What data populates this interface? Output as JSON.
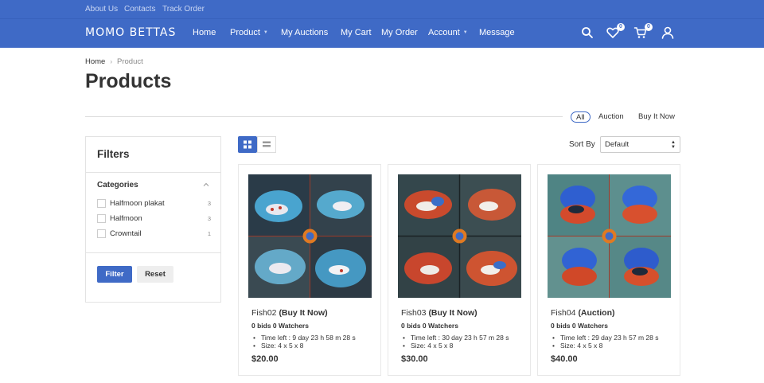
{
  "topbar": {
    "links": [
      "About Us",
      "Contacts",
      "Track Order"
    ]
  },
  "navbar": {
    "logo": "MOMO BETTAS",
    "items": [
      {
        "label": "Home",
        "dropdown": false
      },
      {
        "label": "Product",
        "dropdown": true
      },
      {
        "label": "My Auctions",
        "dropdown": false
      },
      {
        "label": "My Cart",
        "dropdown": false
      },
      {
        "label": "My Order",
        "dropdown": false
      },
      {
        "label": "Account",
        "dropdown": true
      },
      {
        "label": "Message",
        "dropdown": false
      }
    ],
    "icons": {
      "search": "search-icon",
      "wishlist": "heart-icon",
      "wishlist_count": "0",
      "cart": "cart-icon",
      "cart_count": "0",
      "account": "user-icon"
    }
  },
  "breadcrumb": {
    "home": "Home",
    "current": "Product"
  },
  "page_title": "Products",
  "type_tabs": [
    {
      "label": "All",
      "active": true
    },
    {
      "label": "Auction",
      "active": false
    },
    {
      "label": "Buy It Now",
      "active": false
    }
  ],
  "filters": {
    "title": "Filters",
    "categories_title": "Categories",
    "categories": [
      {
        "label": "Halfmoon plakat",
        "count": "3"
      },
      {
        "label": "Halfmoon",
        "count": "3"
      },
      {
        "label": "Crowntail",
        "count": "1"
      }
    ],
    "filter_button": "Filter",
    "reset_button": "Reset"
  },
  "toolbar": {
    "view_grid_icon": "grid-view-icon",
    "view_list_icon": "list-view-icon",
    "sort_label": "Sort By",
    "sort_value": "Default"
  },
  "products": [
    {
      "name": "Fish02",
      "type": "(Buy It Now)",
      "bids": "0 bids 0 Watchers",
      "time_left": "Time left : 9 day 23 h 58 m 28 s",
      "size": "Size: 4 x 5 x 8",
      "price": "$20.00"
    },
    {
      "name": "Fish03",
      "type": "(Buy It Now)",
      "bids": "0 bids 0 Watchers",
      "time_left": "Time left : 30 day 23 h 57 m 28 s",
      "size": "Size: 4 x 5 x 8",
      "price": "$30.00"
    },
    {
      "name": "Fish04",
      "type": "(Auction)",
      "bids": "0 bids 0 Watchers",
      "time_left": "Time left : 29 day 23 h 57 m 28 s",
      "size": "Size: 4 x 5 x 8",
      "price": "$40.00"
    }
  ],
  "colors": {
    "brand": "#3f6ac6",
    "text": "#333333"
  }
}
